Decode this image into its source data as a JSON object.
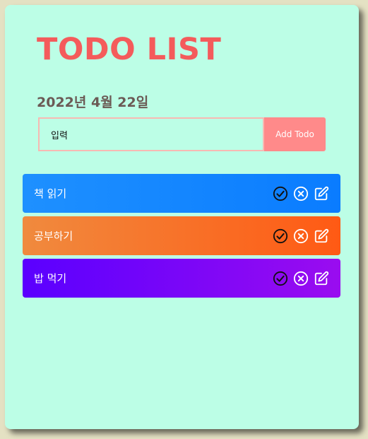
{
  "header": {
    "title": "TODO LIST",
    "date": "2022년 4월 22일"
  },
  "form": {
    "input_value": "입력",
    "add_label": "Add Todo"
  },
  "todos": [
    {
      "label": "책 읽기",
      "gradient_from": "#1e90ff",
      "gradient_to": "#0a7cff",
      "check_color": "#111111"
    },
    {
      "label": "공부하기",
      "gradient_from": "#f08a3e",
      "gradient_to": "#ff5a14",
      "check_color": "#111111"
    },
    {
      "label": "밥 먹기",
      "gradient_from": "#5a00ff",
      "gradient_to": "#9a0cf0",
      "check_color": "#111111"
    }
  ],
  "icons": {
    "check": "check-circle-icon",
    "delete": "x-circle-icon",
    "edit": "edit-icon"
  },
  "colors": {
    "background": "#bcfee6",
    "accent": "#f45b5b",
    "button": "#ff8a8a"
  }
}
